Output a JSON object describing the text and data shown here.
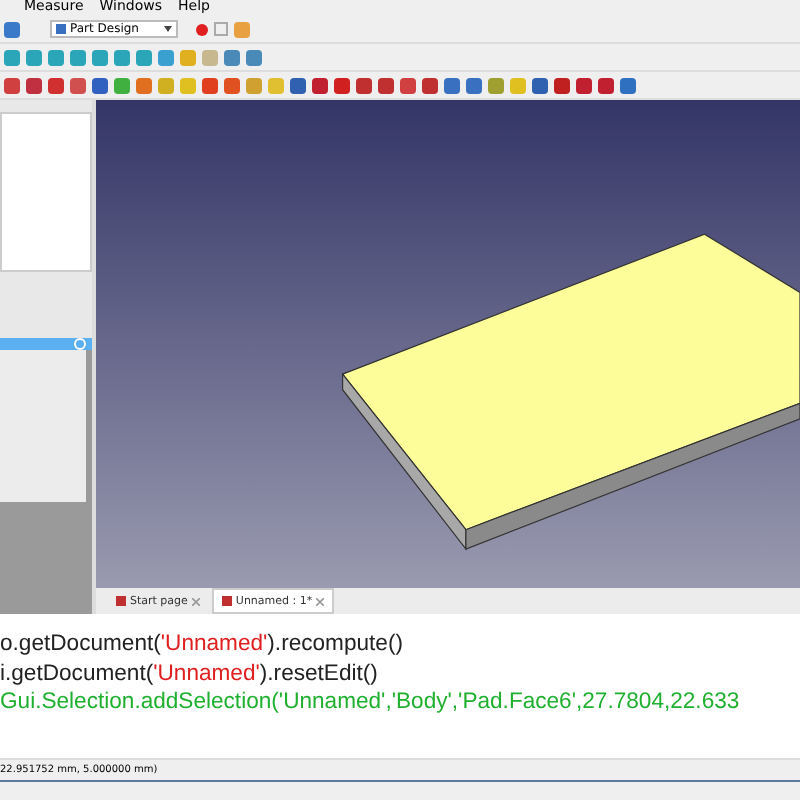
{
  "menu": [
    "Measure",
    "Windows",
    "Help"
  ],
  "workbench": {
    "label": "Part Design"
  },
  "tabs": [
    {
      "label": "Start page",
      "selected": false
    },
    {
      "label": "Unnamed : 1*",
      "selected": true
    }
  ],
  "console": [
    [
      {
        "kind": "plain",
        "text": "o.getDocument("
      },
      {
        "kind": "string",
        "text": "'Unnamed'"
      },
      {
        "kind": "plain",
        "text": ").recompute()"
      }
    ],
    [
      {
        "kind": "plain",
        "text": "i.getDocument("
      },
      {
        "kind": "string",
        "text": "'Unnamed'"
      },
      {
        "kind": "plain",
        "text": ").resetEdit()"
      }
    ],
    [
      {
        "kind": "selection",
        "text": "Gui.Selection.addSelection('Unnamed','Body','Pad.Face6',27.7804,22.633"
      }
    ]
  ],
  "status_bar": "22.951752 mm, 5.000000 mm)"
}
